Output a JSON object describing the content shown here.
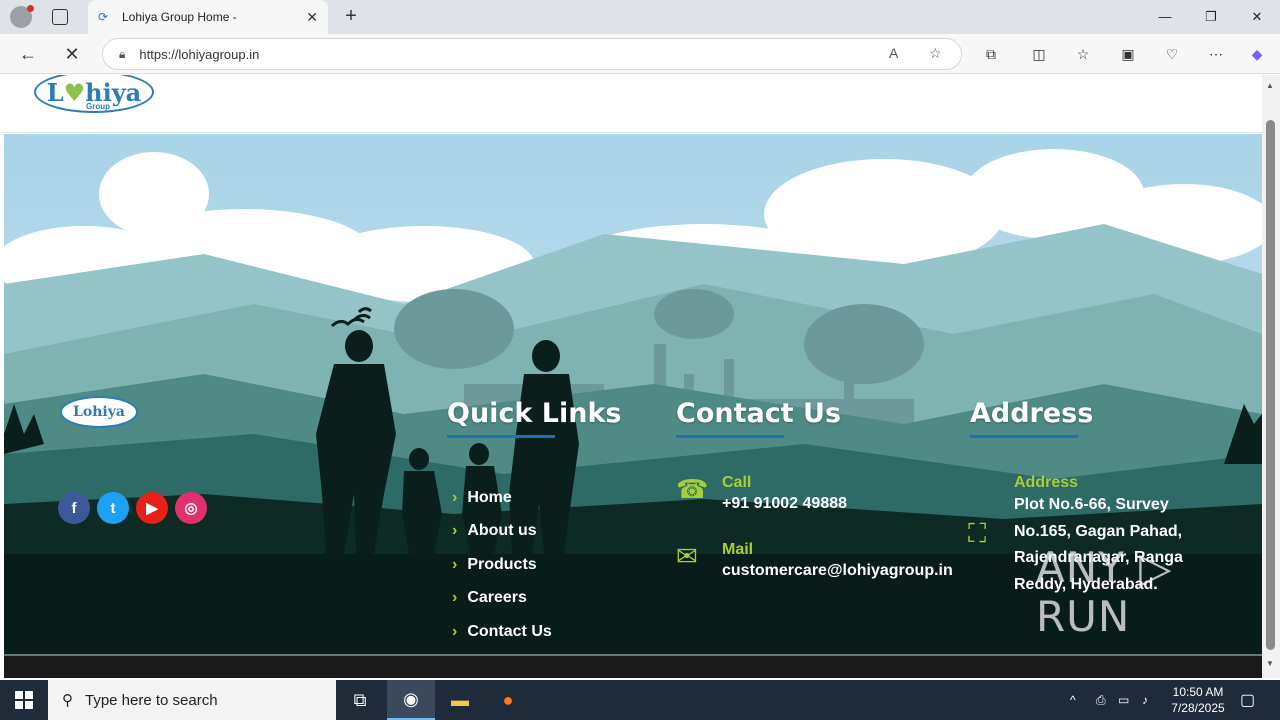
{
  "browser": {
    "tab_title": "Lohiya Group Home -",
    "url": "https://lohiyagroup.in",
    "new_tab": "+",
    "close_tab": "✕"
  },
  "header": {
    "logo_text_1": "L",
    "logo_text_heart": "♥",
    "logo_text_2": "hiya",
    "logo_sub": "Group"
  },
  "footer": {
    "logo_small": "Lohiya",
    "socials": [
      {
        "name": "facebook",
        "glyph": "f"
      },
      {
        "name": "twitter",
        "glyph": "t"
      },
      {
        "name": "youtube",
        "glyph": "▶"
      },
      {
        "name": "instagram",
        "glyph": "◎"
      }
    ],
    "quick_links_title": "Quick Links",
    "quick_links": [
      "Home",
      "About us",
      "Products",
      "Careers",
      "Contact Us"
    ],
    "contact_title": "Contact Us",
    "call_label": "Call",
    "call_value": "+91 91002 49888",
    "mail_label": "Mail",
    "mail_value": "customercare@lohiyagroup.in",
    "address_title": "Address",
    "address_label": "Address",
    "address_value": "Plot No.6-66, Survey No.165, Gagan Pahad, Rajendranagar, Ranga Reddy, Hyderabad."
  },
  "watermark": "ANY ▷ RUN",
  "taskbar": {
    "search_placeholder": "Type here to search",
    "time": "10:50 AM",
    "date": "7/28/2025"
  },
  "colors": {
    "accent_green": "#a6ce39",
    "accent_blue": "#1f6fb2",
    "footer_dark": "#0b1f1a"
  }
}
